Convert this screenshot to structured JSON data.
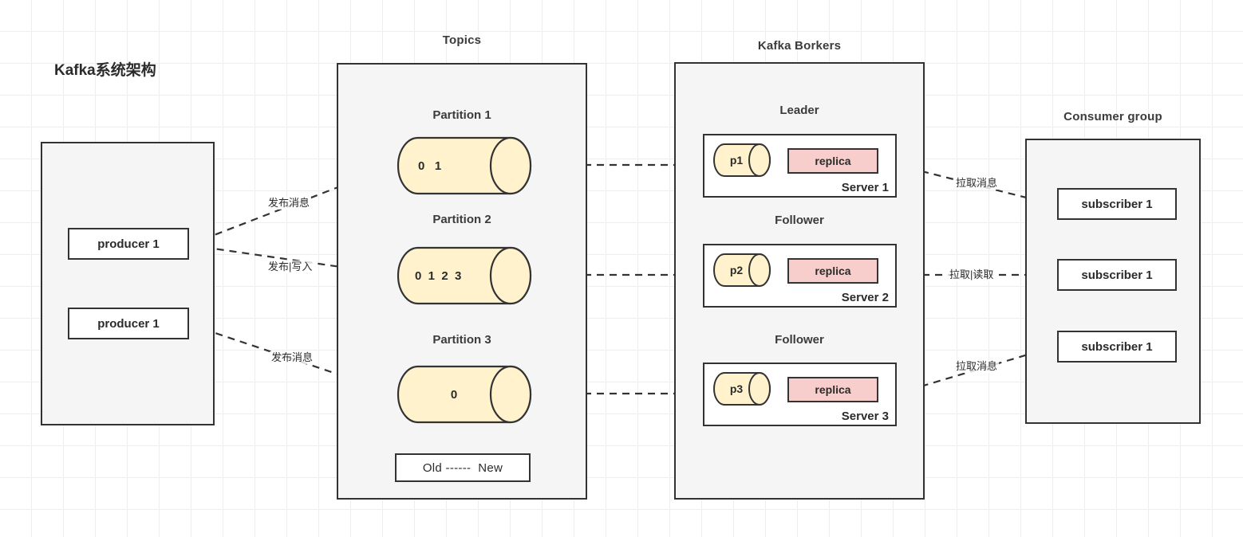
{
  "title": "Kafka系统架构",
  "groups": {
    "topics": "Topics",
    "brokers": "Kafka Borkers",
    "consumer_group": "Consumer group"
  },
  "producers": {
    "items": [
      {
        "label": "producer 1"
      },
      {
        "label": "producer 1"
      }
    ]
  },
  "partitions": [
    {
      "title": "Partition 1",
      "offsets": "0   1"
    },
    {
      "title": "Partition 2",
      "offsets": "0  1  2  3"
    },
    {
      "title": "Partition 3",
      "offsets": "0"
    }
  ],
  "legend": {
    "old_new": "Old ------  New"
  },
  "servers": [
    {
      "role": "Leader",
      "partition": "p1",
      "replica": "replica",
      "name": "Server 1"
    },
    {
      "role": "Follower",
      "partition": "p2",
      "replica": "replica",
      "name": "Server 2"
    },
    {
      "role": "Follower",
      "partition": "p3",
      "replica": "replica",
      "name": "Server 3"
    }
  ],
  "subscribers": [
    {
      "label": "subscriber 1"
    },
    {
      "label": "subscriber 1"
    },
    {
      "label": "subscriber 1"
    }
  ],
  "edge_labels": {
    "publish_1": "发布消息",
    "publish_2": "发布|写入",
    "publish_3": "发布消息",
    "pull_1": "拉取消息",
    "pull_2": "拉取|读取",
    "pull_3": "拉取消息"
  },
  "colors": {
    "panel_fill": "#f5f5f5",
    "stroke": "#333333",
    "cylinder_fill": "#fff2cc",
    "replica_fill": "#f8cecc",
    "grid": "#eceef0"
  }
}
